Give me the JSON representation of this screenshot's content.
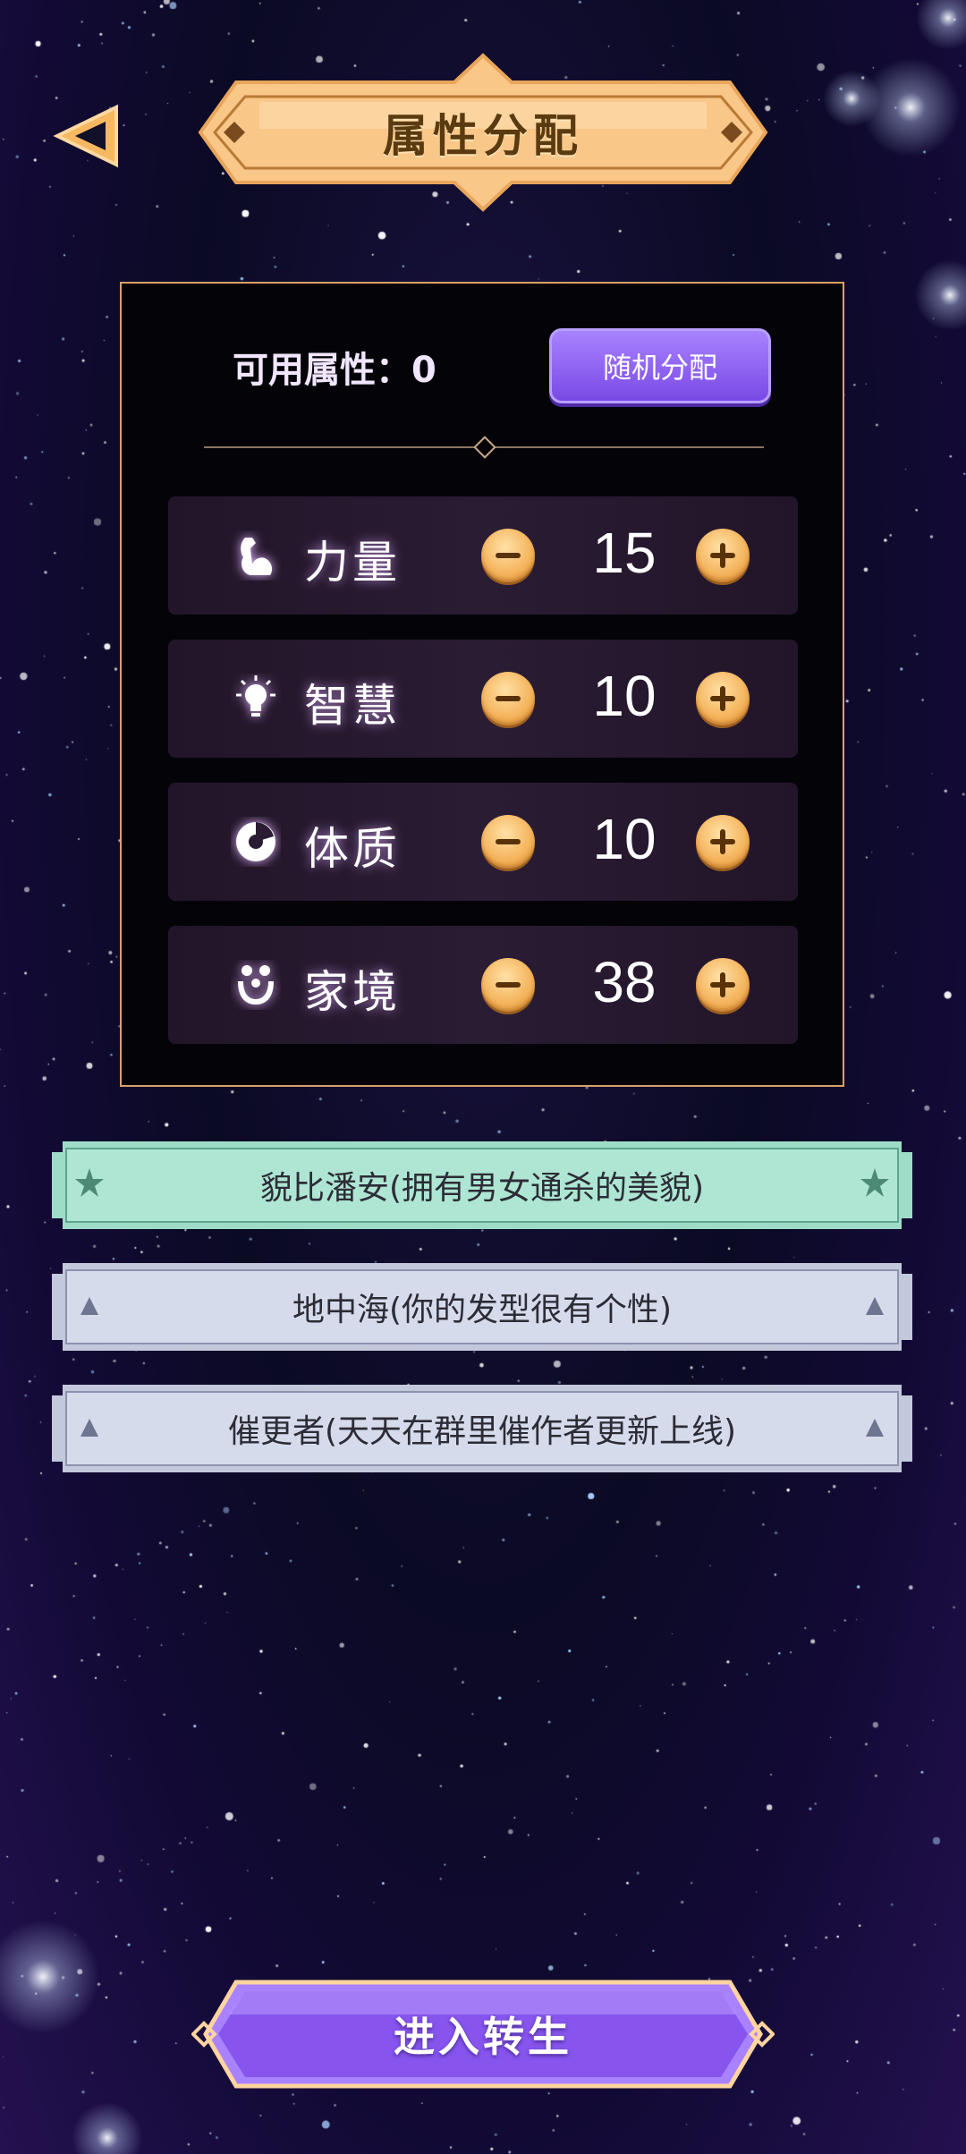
{
  "header": {
    "back_icon": "back-triangle-icon",
    "title": "属性分配"
  },
  "panel": {
    "available_label": "可用属性：",
    "available_points": "0",
    "random_button": "随机分配",
    "attributes": [
      {
        "label": "力量",
        "value": "15",
        "icon": "muscle-icon"
      },
      {
        "label": "智慧",
        "value": "10",
        "icon": "lightbulb-icon"
      },
      {
        "label": "体质",
        "value": "10",
        "icon": "constitution-icon"
      },
      {
        "label": "家境",
        "value": "38",
        "icon": "family-icon"
      }
    ]
  },
  "traits": [
    {
      "text": "貌比潘安(拥有男女通杀的美貌)",
      "rarity": "rare",
      "color": "#a4e3cf",
      "icon": "star-icon"
    },
    {
      "text": "地中海(你的发型很有个性)",
      "rarity": "common",
      "color": "#cfd4e6",
      "icon": "triangle-icon"
    },
    {
      "text": "催更者(天天在群里催作者更新上线)",
      "rarity": "common",
      "color": "#cfd4e6",
      "icon": "triangle-icon"
    }
  ],
  "footer": {
    "enter_button": "进入转生"
  },
  "colors": {
    "gold": "#f4b25a",
    "purple_button": "#8a5cf0",
    "panel_border": "#d9a06a"
  }
}
